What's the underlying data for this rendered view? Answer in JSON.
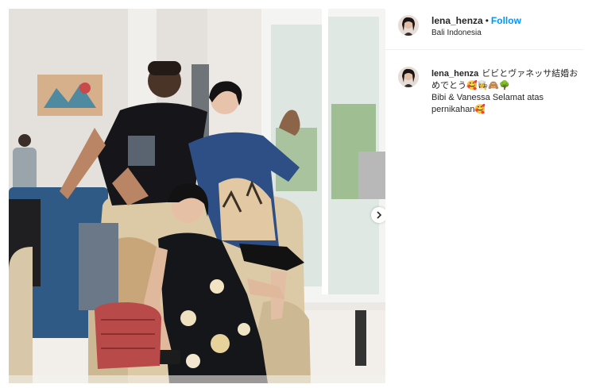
{
  "post": {
    "image_alt": "",
    "next_icon": "chevron-right-icon"
  },
  "header": {
    "username": "lena_henza",
    "separator": "•",
    "follow_label": "Follow",
    "location": "Bali Indonesia"
  },
  "caption": {
    "username": "lena_henza",
    "line1": "ビビとヴァネッサ結婚おめでとう🥰👩‍🍳🙈🌳",
    "line2": "Bibi & Vanessa Selamat atas",
    "line3": "pernikahan🥰"
  },
  "colors": {
    "follow": "#0095f6",
    "divider": "#efefef"
  }
}
